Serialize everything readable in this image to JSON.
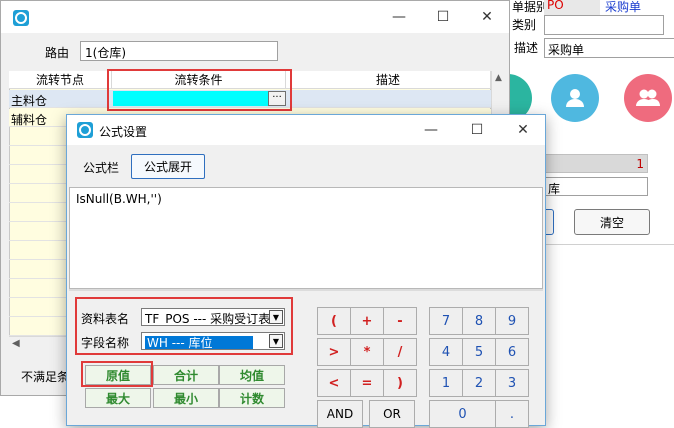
{
  "bg_app": {
    "doc_type_label": "单据别",
    "doc_type_code": "PO",
    "doc_type_name": "采购单",
    "category_label": "类别",
    "desc_label": "描述",
    "desc_value": "采购单",
    "number_value": "1",
    "warehouse_value": "库",
    "clear_button": "清空"
  },
  "route_window": {
    "route_label": "路由",
    "route_value": "1(仓库)",
    "columns": [
      "流转节点",
      "流转条件",
      "描述"
    ],
    "rows": [
      {
        "node": "主料仓",
        "condition": "",
        "desc": ""
      },
      {
        "node": "辅料仓",
        "condition": "",
        "desc": ""
      }
    ],
    "ellipsis": "···",
    "bottom_text": "不满足条"
  },
  "formula_dialog": {
    "title": "公式设置",
    "formula_bar_label": "公式栏",
    "expand_button": "公式展开",
    "formula_text": "IsNull(B.WH,'')",
    "table_label": "资料表名",
    "table_value": "TF_POS --- 采购受订表",
    "field_label": "字段名称",
    "field_value": "WH --- 库位",
    "functions": [
      "原值",
      "合计",
      "均值",
      "最大",
      "最小",
      "计数"
    ],
    "operators": [
      "(",
      "+",
      "-",
      ">",
      "*",
      "/",
      "<",
      "=",
      ")"
    ],
    "logic": [
      "AND",
      "OR"
    ],
    "digits": [
      "7",
      "8",
      "9",
      "4",
      "5",
      "6",
      "1",
      "2",
      "3",
      "0",
      "."
    ]
  },
  "colors": {
    "highlight": "#e03a3a",
    "cyan_cell": "#00ffff",
    "selection": "#0078d7",
    "teal_button": "#2bb5a0",
    "blue_button": "#4fb8e0",
    "pink_button": "#ef6b7e"
  }
}
